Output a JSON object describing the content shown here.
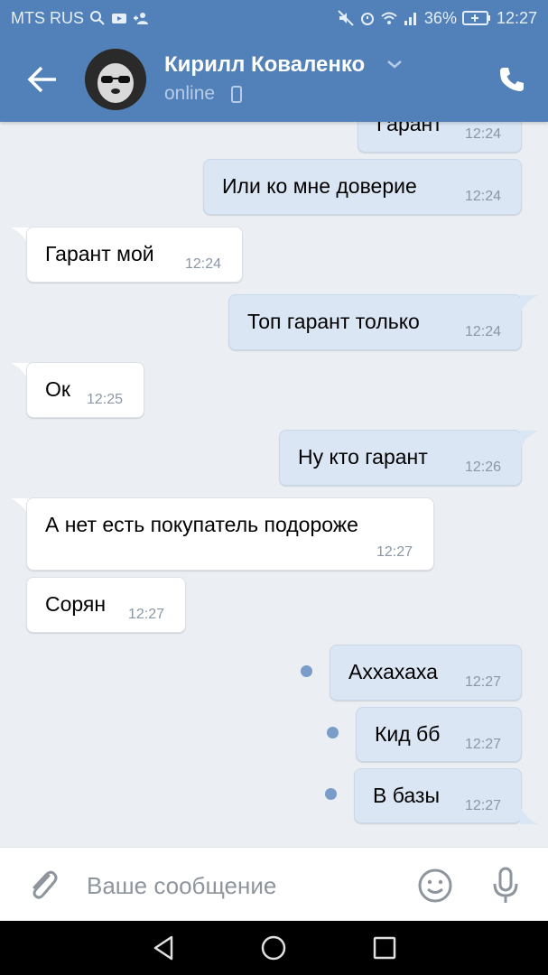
{
  "status_bar": {
    "carrier": "MTS RUS",
    "battery": "36%",
    "time": "12:27"
  },
  "header": {
    "contact_name": "Кирилл Коваленко",
    "status": "online"
  },
  "messages": [
    {
      "text": "Гарант",
      "time": "12:24",
      "direction": "out"
    },
    {
      "text": "Или ко мне доверие",
      "time": "12:24",
      "direction": "out"
    },
    {
      "text": "Гарант мой",
      "time": "12:24",
      "direction": "in"
    },
    {
      "text": "Топ гарант только",
      "time": "12:24",
      "direction": "out"
    },
    {
      "text": "Ок",
      "time": "12:25",
      "direction": "in"
    },
    {
      "text": "Ну кто гарант",
      "time": "12:26",
      "direction": "out"
    },
    {
      "text": "А нет есть покупатель подороже",
      "time": "12:27",
      "direction": "in"
    },
    {
      "text": "Сорян",
      "time": "12:27",
      "direction": "in"
    },
    {
      "text": "Аххахаха",
      "time": "12:27",
      "direction": "out",
      "unread": true
    },
    {
      "text": "Кид бб",
      "time": "12:27",
      "direction": "out",
      "unread": true
    },
    {
      "text": "В базы",
      "time": "12:27",
      "direction": "out",
      "unread": true
    }
  ],
  "composer": {
    "placeholder": "Ваше сообщение"
  },
  "colors": {
    "header": "#5181b8",
    "outgoing_bubble": "#dbe6f4",
    "incoming_bubble": "#ffffff",
    "background": "#ebeef2"
  }
}
